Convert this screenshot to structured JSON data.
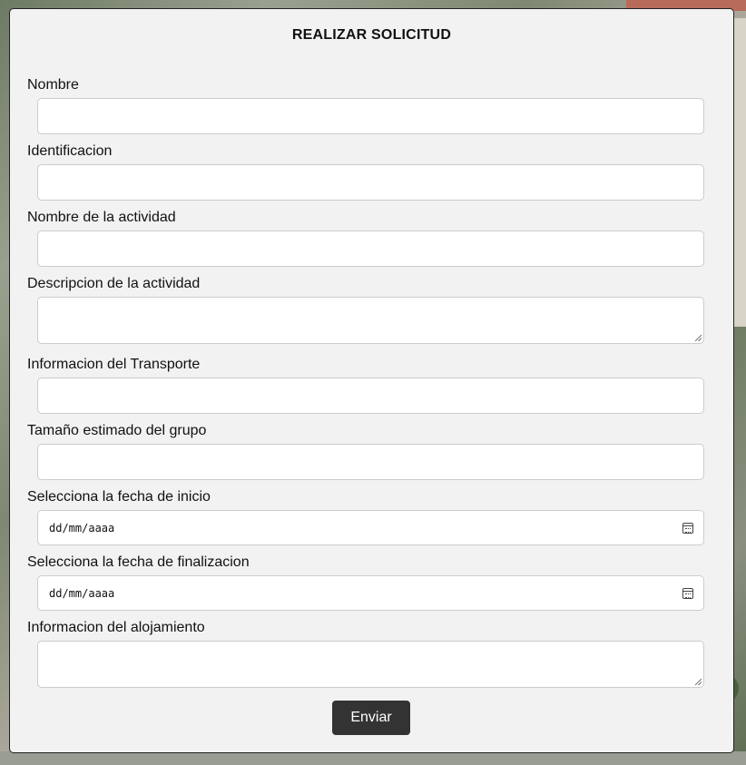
{
  "form": {
    "title": "REALIZAR SOLICITUD",
    "fields": [
      {
        "label": "Nombre",
        "type": "text",
        "value": ""
      },
      {
        "label": "Identificacion",
        "type": "text",
        "value": ""
      },
      {
        "label": "Nombre de la actividad",
        "type": "text",
        "value": ""
      },
      {
        "label": "Descripcion de la actividad",
        "type": "textarea",
        "value": ""
      },
      {
        "label": "Informacion del Transporte",
        "type": "text",
        "value": ""
      },
      {
        "label": "Tamaño estimado del grupo",
        "type": "text",
        "value": ""
      },
      {
        "label": "Selecciona la fecha de inicio",
        "type": "date",
        "placeholder": "dd/mm/aaaa"
      },
      {
        "label": "Selecciona la fecha de finalizacion",
        "type": "date",
        "placeholder": "dd/mm/aaaa"
      },
      {
        "label": "Informacion del alojamiento",
        "type": "textarea",
        "value": ""
      }
    ],
    "submit_label": "Enviar"
  },
  "icons": {
    "date_picker": "calendar-icon"
  }
}
